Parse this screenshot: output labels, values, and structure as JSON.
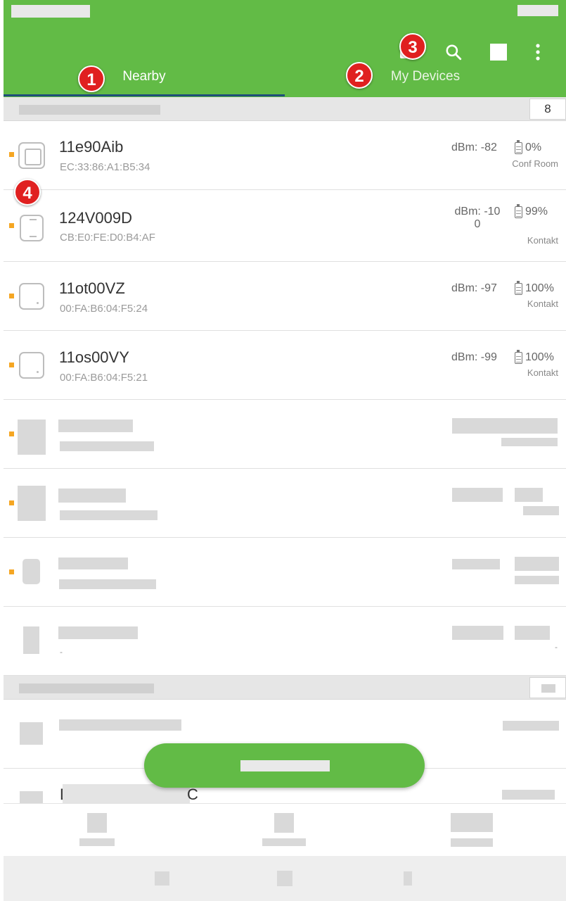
{
  "header": {
    "tabs": [
      {
        "label": "Nearby",
        "active": true
      },
      {
        "label": "My Devices",
        "active": false
      }
    ],
    "actions": [
      {
        "icon": "cast-icon"
      },
      {
        "icon": "search-icon"
      },
      {
        "icon": "square-icon"
      },
      {
        "icon": "more-vert-icon"
      }
    ],
    "accent_color": "#62bb46",
    "indicator_color": "#1e4f7a"
  },
  "annotations": [
    "1",
    "2",
    "3",
    "4"
  ],
  "section_nearby": {
    "count": "8"
  },
  "devices": [
    {
      "name": "11e90Aib",
      "mac": "EC:33:86:A1:B5:34",
      "dbm": "dBm: -82",
      "battery": "0%",
      "tag": "Conf Room"
    },
    {
      "name": "124V009D",
      "mac": "CB:E0:FE:D0:B4:AF",
      "dbm_line1": "dBm: -10",
      "dbm_line2": "0",
      "battery": "99%",
      "tag": "Kontakt"
    },
    {
      "name": "11ot00VZ",
      "mac": "00:FA:B6:04:F5:24",
      "dbm": "dBm: -97",
      "battery": "100%",
      "tag": "Kontakt"
    },
    {
      "name": "11os00VY",
      "mac": "00:FA:B6:04:F5:21",
      "dbm": "dBm: -99",
      "battery": "100%",
      "tag": "Kontakt"
    }
  ],
  "fragments": {
    "dash": "-",
    "partial_left": "D",
    "partial_right": "C"
  },
  "status_color": "#f5a623"
}
